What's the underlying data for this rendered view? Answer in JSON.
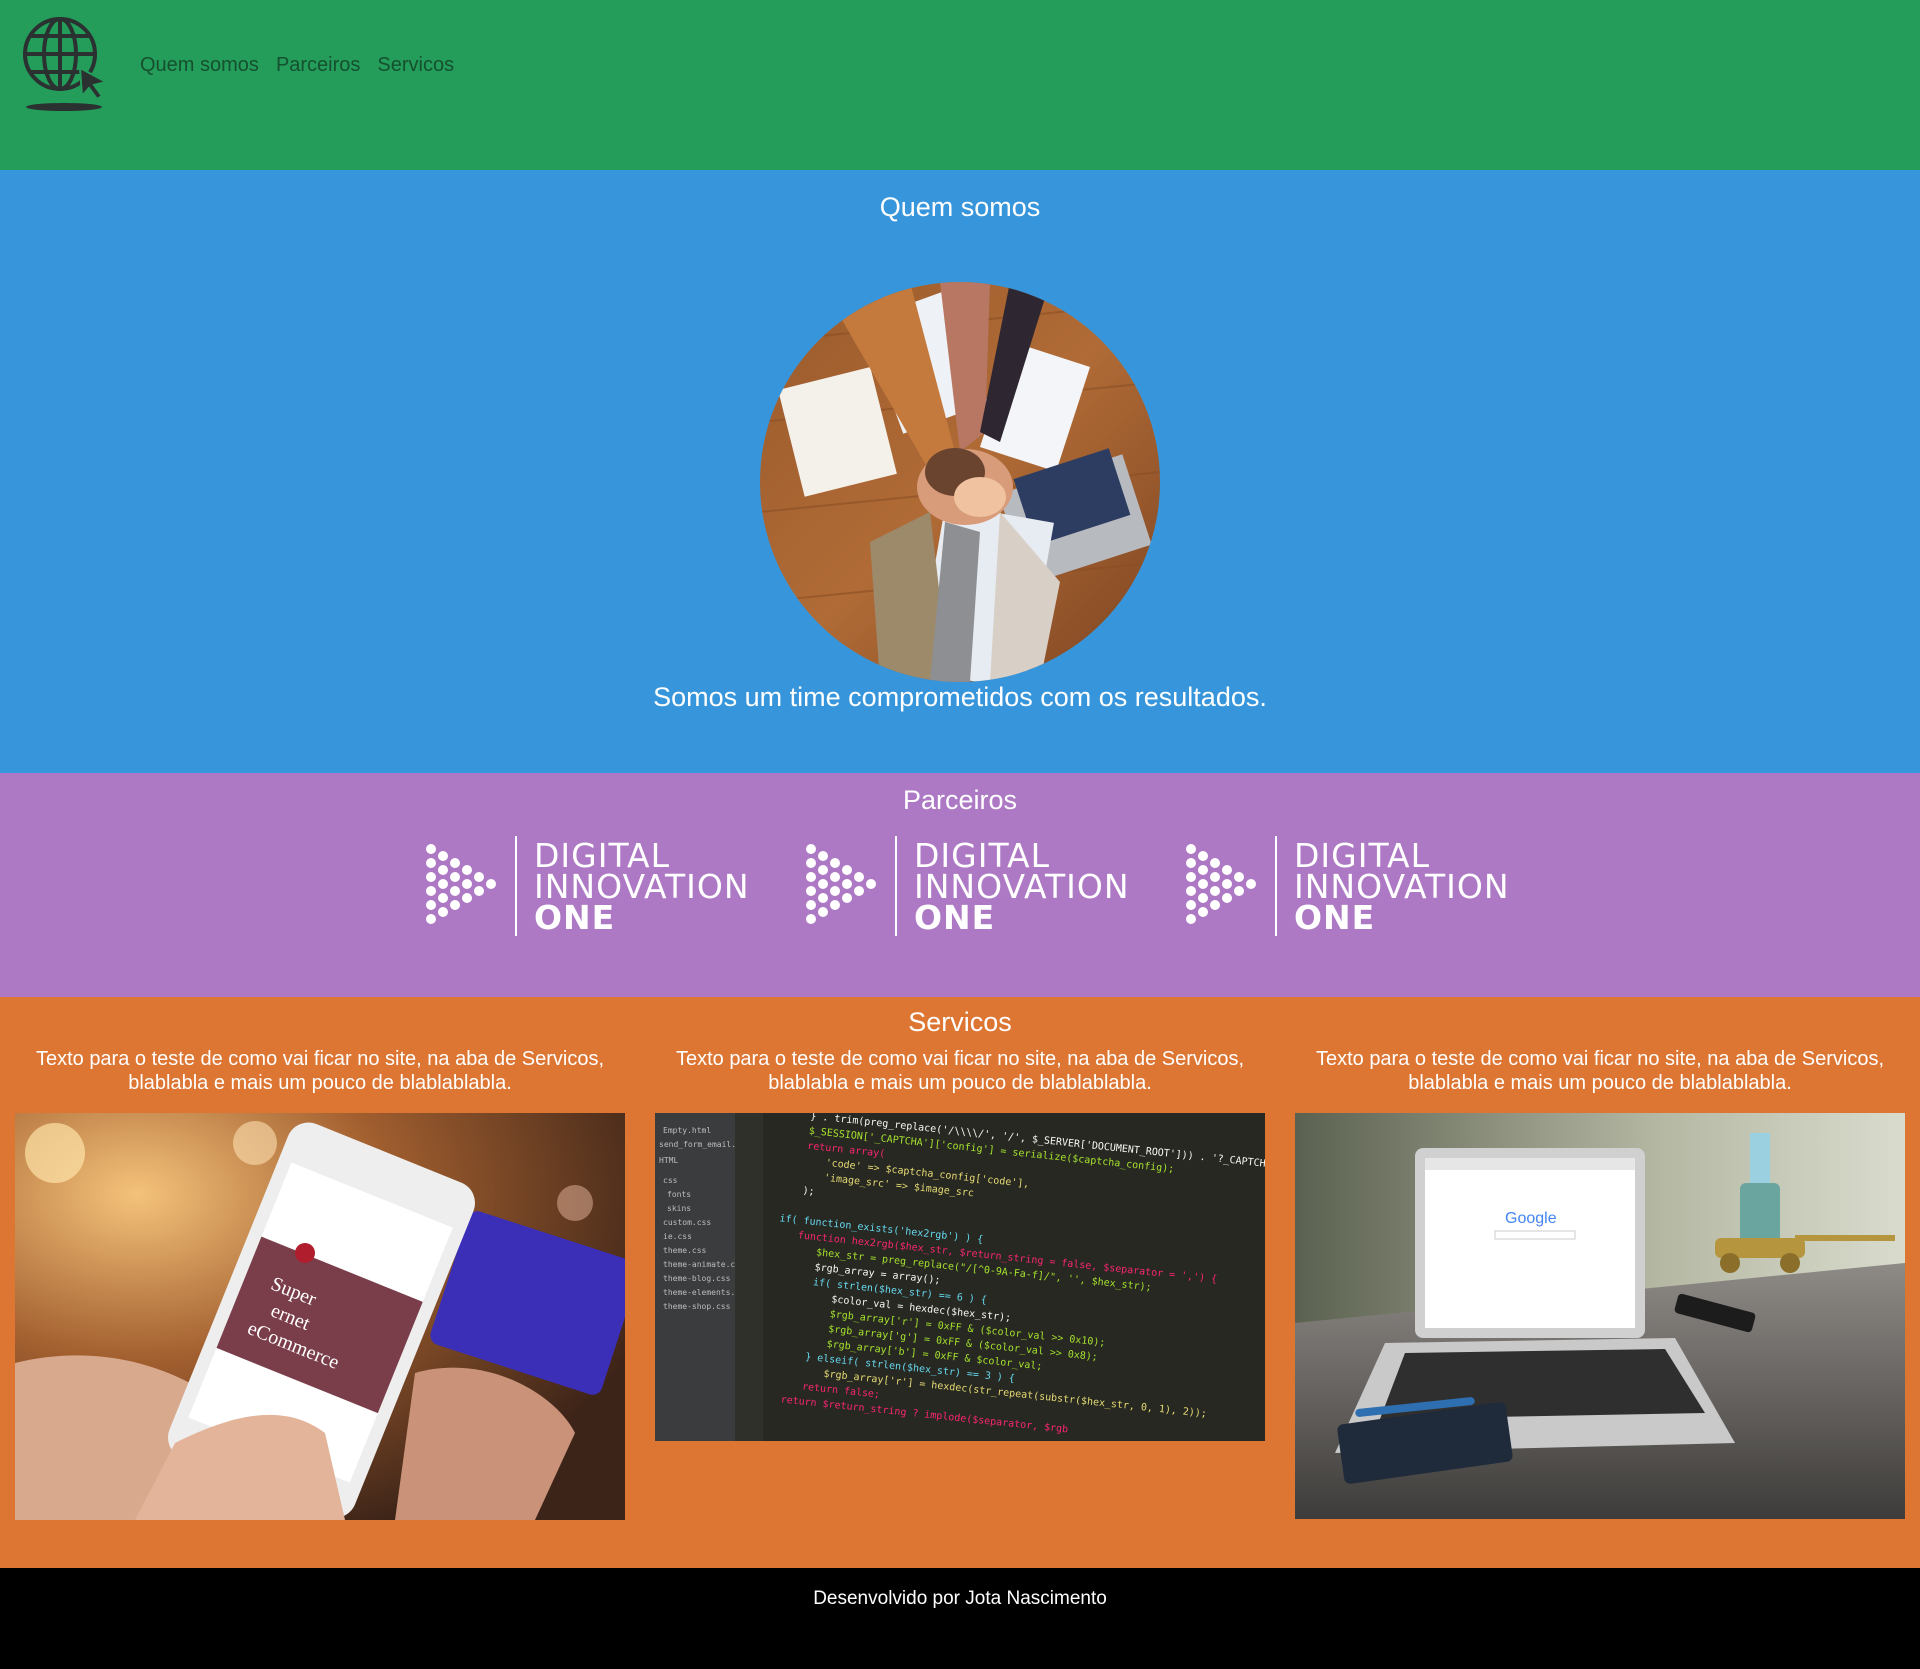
{
  "header": {
    "logo_icon": "globe-cursor-icon",
    "nav": [
      {
        "label": "Quem somos"
      },
      {
        "label": "Parceiros"
      },
      {
        "label": "Servicos"
      }
    ],
    "background": "#249c5a"
  },
  "quem_somos": {
    "title": "Quem somos",
    "image": "team-hands-photo",
    "tagline": "Somos um time comprometidos com os resultados.",
    "background": "#3796db"
  },
  "parceiros": {
    "title": "Parceiros",
    "logos": [
      {
        "line1": "DIGITAL",
        "line2": "INNOVATION",
        "line3": "ONE"
      },
      {
        "line1": "DIGITAL",
        "line2": "INNOVATION",
        "line3": "ONE"
      },
      {
        "line1": "DIGITAL",
        "line2": "INNOVATION",
        "line3": "ONE"
      }
    ],
    "background": "#ad79c4"
  },
  "servicos": {
    "title": "Servicos",
    "items": [
      {
        "text": "Texto para o teste de como vai ficar no site, na aba de Servicos, blablabla e mais um pouco de blablablabla.",
        "image": "smartphone-ecommerce-photo"
      },
      {
        "text": "Texto para o teste de como vai ficar no site, na aba de Servicos, blablabla e mais um pouco de blablablabla.",
        "image": "code-editor-photo"
      },
      {
        "text": "Texto para o teste de como vai ficar no site, na aba de Servicos, blablabla e mais um pouco de blablablabla.",
        "image": "laptop-desk-photo"
      }
    ],
    "background": "#dd7633"
  },
  "footer": {
    "text": "Desenvolvido por Jota Nascimento"
  }
}
